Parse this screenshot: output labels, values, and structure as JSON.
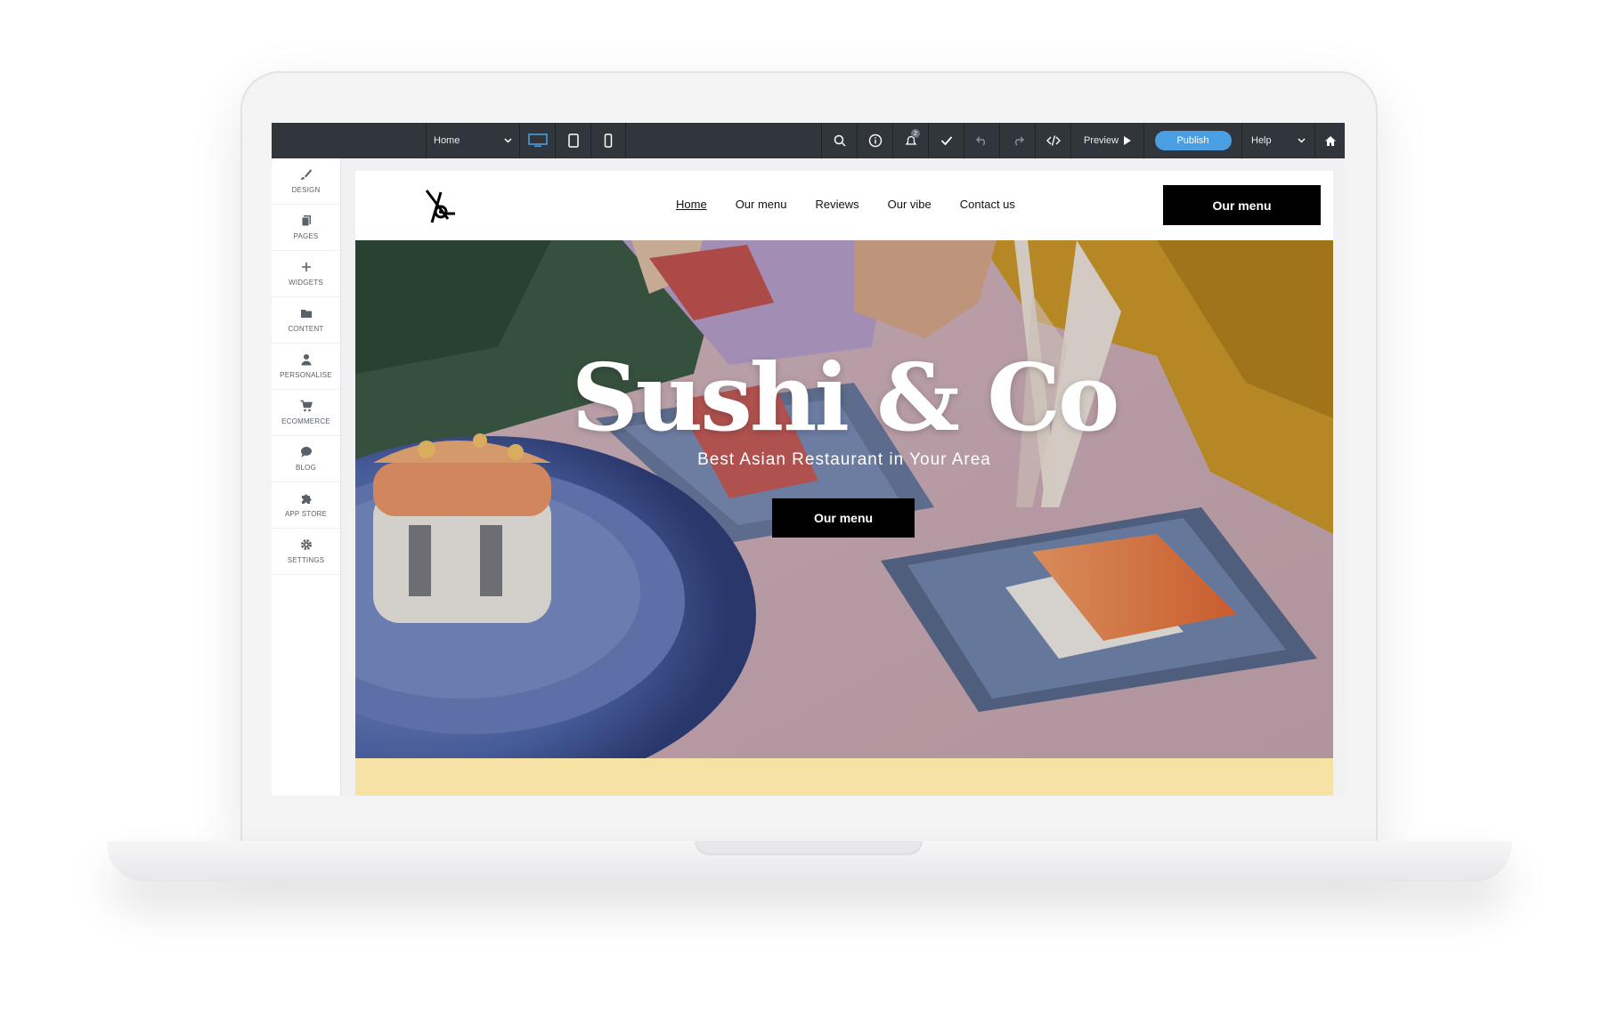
{
  "editor": {
    "page_select": "Home",
    "notifications_count": "2",
    "preview_label": "Preview",
    "publish_label": "Publish",
    "help_label": "Help"
  },
  "sidebar": {
    "items": [
      {
        "label": "DESIGN",
        "icon": "brush-icon"
      },
      {
        "label": "PAGES",
        "icon": "pages-icon"
      },
      {
        "label": "WIDGETS",
        "icon": "plus-icon"
      },
      {
        "label": "CONTENT",
        "icon": "folder-icon"
      },
      {
        "label": "PERSONALISE",
        "icon": "person-icon"
      },
      {
        "label": "ECOMMERCE",
        "icon": "cart-icon"
      },
      {
        "label": "BLOG",
        "icon": "chat-bubble-icon"
      },
      {
        "label": "APP STORE",
        "icon": "puzzle-icon"
      },
      {
        "label": "SETTINGS",
        "icon": "gear-icon"
      }
    ]
  },
  "site": {
    "nav": [
      "Home",
      "Our menu",
      "Reviews",
      "Our vibe",
      "Contact us"
    ],
    "header_cta": "Our menu",
    "hero_title": "Sushi & Co",
    "hero_subtitle": "Best Asian Restaurant in Your Area",
    "hero_cta": "Our menu"
  },
  "colors": {
    "toolbar": "#30363b",
    "accent": "#4a9fe3",
    "band": "#f6e2a5"
  }
}
